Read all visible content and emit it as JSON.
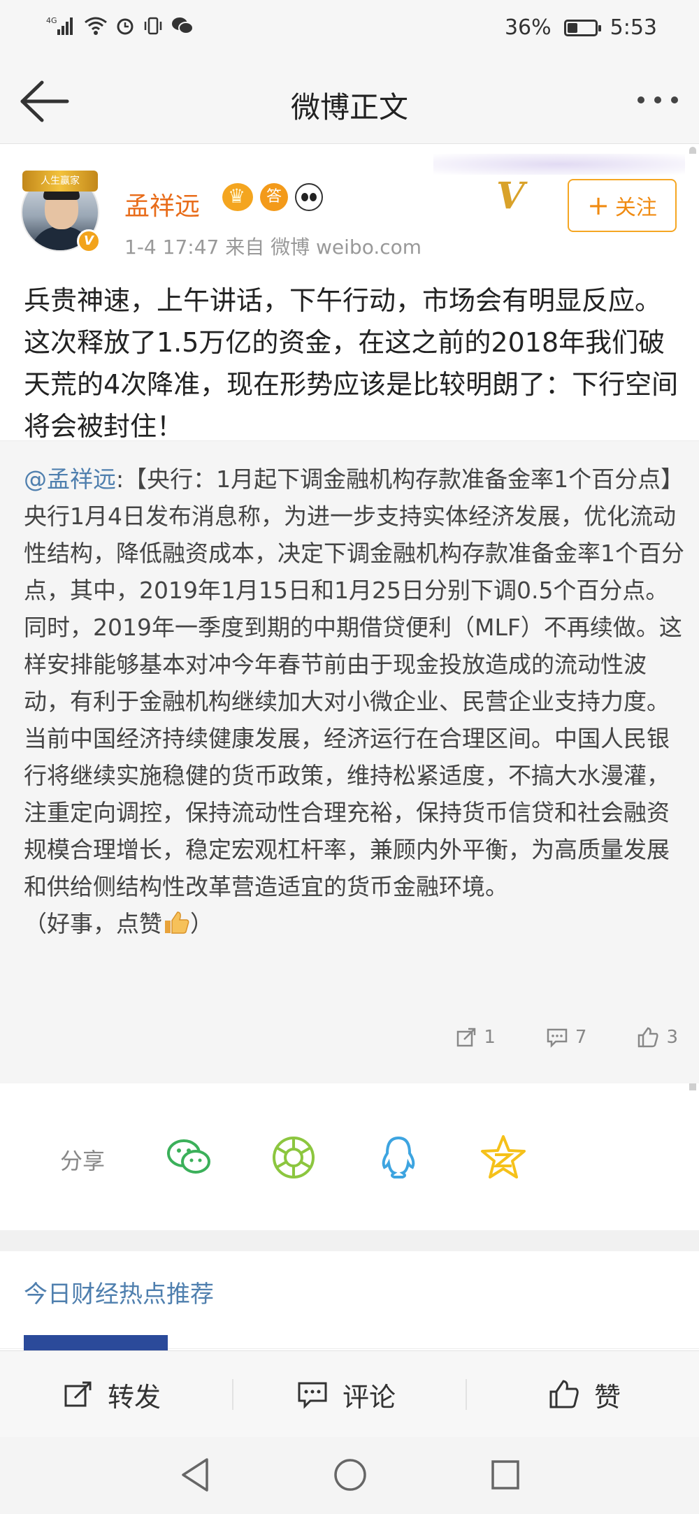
{
  "status_bar": {
    "network": "4G",
    "battery_percent_text": "36%",
    "battery_level": 0.36,
    "time": "5:53"
  },
  "nav": {
    "title": "微博正文"
  },
  "post": {
    "author": "孟祥远",
    "avatar_banner": "人生赢家",
    "badge_answer": "答",
    "meta": "1-4 17:47  来自 微博 weibo.com",
    "follow_label": "关注",
    "text": "兵贵神速，上午讲话，下午行动，市场会有明显反应。这次释放了1.5万亿的资金，在这之前的2018年我们破天荒的4次降准，现在形势应该是比较明朗了：下行空间将会被封住！"
  },
  "repost": {
    "mention": "@孟祥远",
    "text_p1": ":【央行：1月起下调金融机构存款准备金率1个百分点】央行1月4日发布消息称，为进一步支持实体经济发展，优化流动性结构，降低融资成本，决定下调金融机构存款准备金率1个百分点，其中，2019年1月15日和1月25日分别下调0.5个百分点。同时，2019年一季度到期的中期借贷便利（MLF）不再续做。这样安排能够基本对冲今年春节前由于现金投放造成的流动性波动，有利于金融机构继续加大对小微企业、民营企业支持力度。",
    "text_p2": "当前中国经济持续健康发展，经济运行在合理区间。中国人民银行将继续实施稳健的货币政策，维持松紧适度，不搞大水漫灌，注重定向调控，保持流动性合理充裕，保持货币信贷和社会融资规模合理增长，稳定宏观杠杆率，兼顾内外平衡，为高质量发展和供给侧结构性改革营造适宜的货币金融环境。",
    "text_p3_pre": "（好事，点赞",
    "text_p3_post": "）",
    "repost_count": "1",
    "comment_count": "7",
    "like_count": "3"
  },
  "share": {
    "label": "分享",
    "targets": [
      "wechat-icon",
      "moments-icon",
      "qq-icon",
      "qzone-icon"
    ]
  },
  "recommend": {
    "title": "今日财经热点推荐"
  },
  "actions": {
    "repost": "转发",
    "comment": "评论",
    "like": "赞"
  },
  "colors": {
    "username": "#e86c1a",
    "link": "#4f7fae",
    "follow": "#f08b12",
    "wechat": "#3bb05a",
    "moments": "#8cc63f",
    "qq": "#3da4e0",
    "qzone": "#f5c11a"
  }
}
